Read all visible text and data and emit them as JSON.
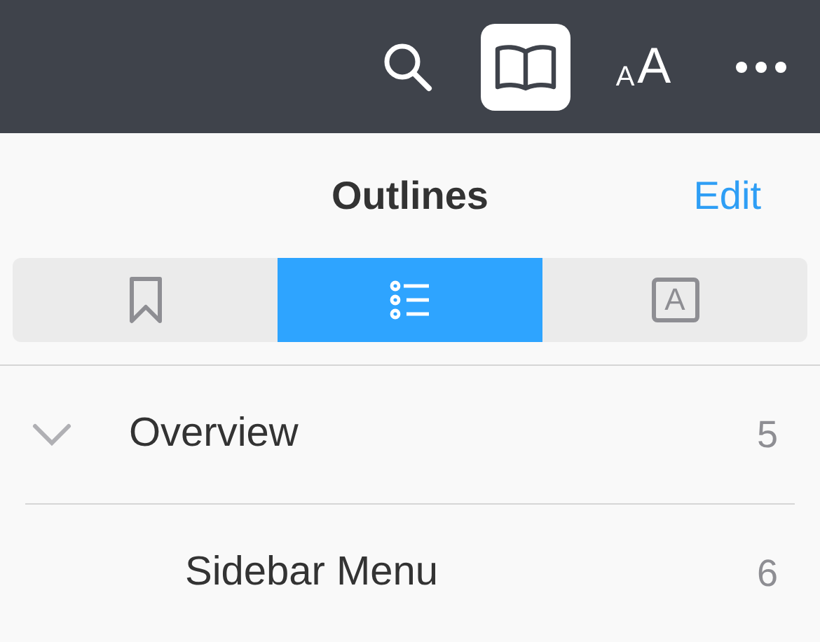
{
  "toolbar": [
    {
      "kind": "search",
      "selected": false
    },
    {
      "kind": "book",
      "selected": true
    },
    {
      "kind": "text-size",
      "label_small": "A",
      "label_large": "A",
      "selected": false
    },
    {
      "kind": "more",
      "selected": false
    }
  ],
  "header": {
    "title": "Outlines",
    "action": "Edit"
  },
  "segments": [
    {
      "kind": "bookmark",
      "selected": false
    },
    {
      "kind": "list",
      "selected": true
    },
    {
      "kind": "annotation",
      "label": "A",
      "selected": false
    }
  ],
  "outline": [
    {
      "label": "Overview",
      "count": "5",
      "expanded": true,
      "children": [
        {
          "label": "Sidebar Menu",
          "count": "6"
        }
      ]
    }
  ]
}
